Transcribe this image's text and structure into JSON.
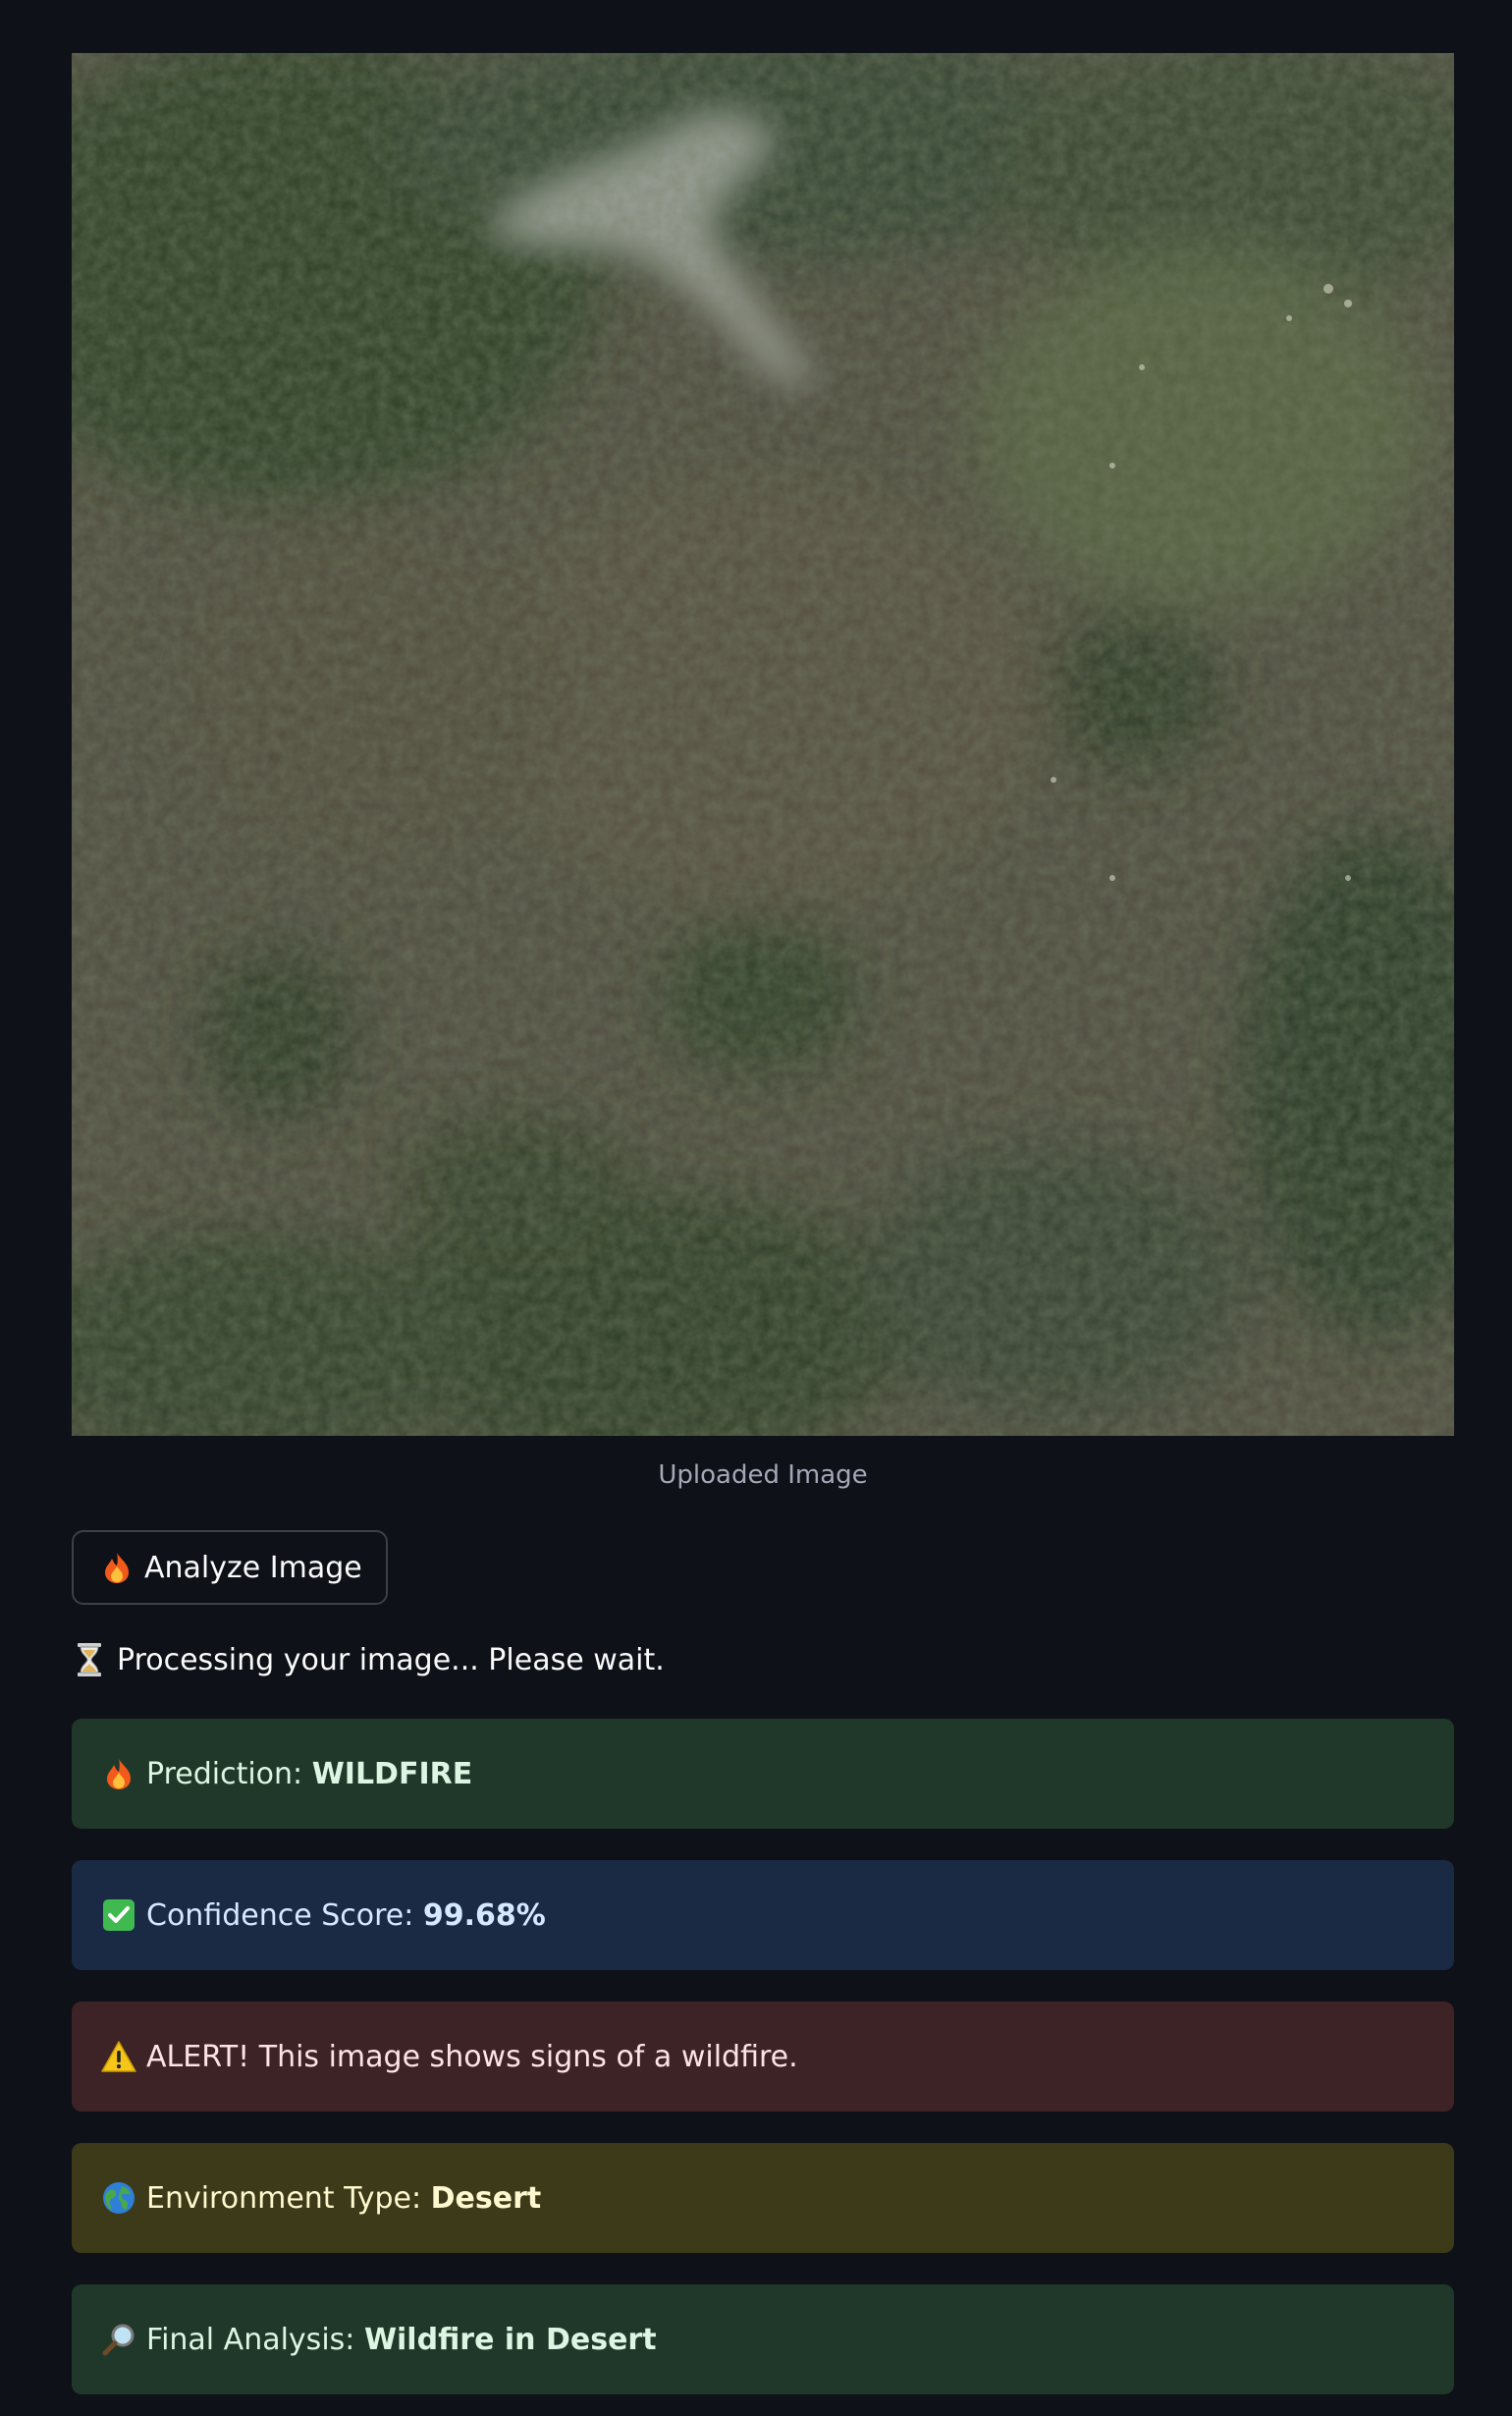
{
  "image": {
    "caption": "Uploaded Image",
    "description_icon": "satellite-forest-image"
  },
  "analyze_button": {
    "icon": "fire-icon",
    "label": "Analyze Image"
  },
  "status": {
    "icon": "hourglass-icon",
    "text": "Processing your image... Please wait."
  },
  "results": {
    "prediction": {
      "icon": "fire-icon",
      "label": "Prediction: ",
      "value": "WILDFIRE",
      "color": "#1f3829"
    },
    "confidence": {
      "icon": "check-mark-icon",
      "label": "Confidence Score: ",
      "value": "99.68%",
      "color": "#1b2a44"
    },
    "alert": {
      "icon": "warning-icon",
      "text": "ALERT! This image shows signs of a wildfire.",
      "color": "#3d2226"
    },
    "environment": {
      "icon": "globe-icon",
      "label": "Environment Type: ",
      "value": "Desert",
      "color": "#3d3a1a"
    },
    "final": {
      "icon": "magnifier-icon",
      "label": "Final Analysis: ",
      "value": "Wildfire in Desert",
      "color": "#1f3829"
    }
  }
}
